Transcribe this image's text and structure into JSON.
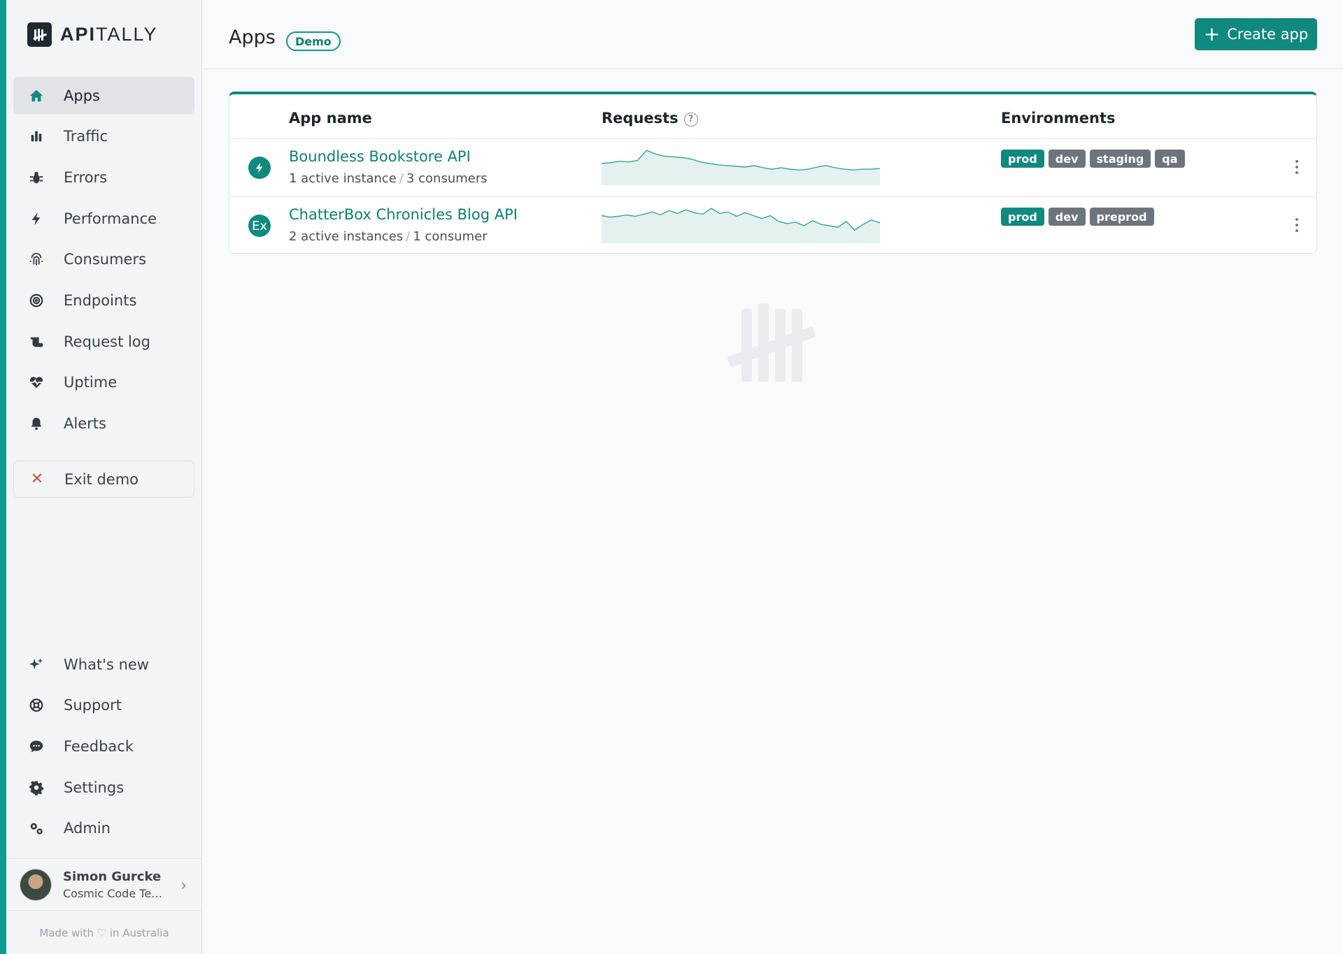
{
  "brand": {
    "name_bold": "API",
    "name_light": "TALLY"
  },
  "sidebar": {
    "items": [
      {
        "label": "Apps",
        "icon": "home-icon",
        "active": true
      },
      {
        "label": "Traffic",
        "icon": "bar-chart-icon"
      },
      {
        "label": "Errors",
        "icon": "bug-icon"
      },
      {
        "label": "Performance",
        "icon": "bolt-icon"
      },
      {
        "label": "Consumers",
        "icon": "fingerprint-icon"
      },
      {
        "label": "Endpoints",
        "icon": "target-icon"
      },
      {
        "label": "Request log",
        "icon": "scroll-icon"
      },
      {
        "label": "Uptime",
        "icon": "heartbeat-icon"
      },
      {
        "label": "Alerts",
        "icon": "bell-icon"
      }
    ],
    "exit_label": "Exit demo",
    "bottom_items": [
      {
        "label": "What's new",
        "icon": "sparkles-icon"
      },
      {
        "label": "Support",
        "icon": "lifebuoy-icon"
      },
      {
        "label": "Feedback",
        "icon": "chat-icon"
      },
      {
        "label": "Settings",
        "icon": "gear-icon"
      },
      {
        "label": "Admin",
        "icon": "gears-icon"
      }
    ]
  },
  "user": {
    "name": "Simon Gurcke",
    "org": "Cosmic Code Tea..."
  },
  "footer": {
    "prefix": "Made with",
    "suffix": "in Australia"
  },
  "header": {
    "title": "Apps",
    "badge": "Demo",
    "create_label": "Create app"
  },
  "table": {
    "columns": {
      "name": "App name",
      "requests": "Requests",
      "envs": "Environments"
    },
    "rows": [
      {
        "name": "Boundless Bookstore API",
        "instances": "1 active instance",
        "consumers": "3 consumers",
        "icon": "bolt-icon",
        "icon_text": "",
        "environments": [
          "prod",
          "dev",
          "staging",
          "qa"
        ],
        "requests_trend": [
          30,
          31,
          33,
          32,
          34,
          48,
          43,
          40,
          39,
          38,
          36,
          32,
          30,
          28,
          27,
          26,
          25,
          27,
          24,
          22,
          24,
          22,
          21,
          22,
          25,
          27,
          24,
          22,
          21,
          22,
          22,
          23
        ]
      },
      {
        "name": "ChatterBox Chronicles Blog API",
        "instances": "2 active instances",
        "consumers": "1 consumer",
        "icon": "text-badge-icon",
        "icon_text": "Ex",
        "environments": [
          "prod",
          "dev",
          "preprod"
        ],
        "requests_trend": [
          38,
          36,
          37,
          39,
          37,
          40,
          43,
          39,
          45,
          41,
          46,
          42,
          40,
          48,
          41,
          43,
          37,
          42,
          38,
          34,
          38,
          30,
          27,
          29,
          24,
          31,
          26,
          24,
          22,
          30,
          18,
          26,
          32,
          28
        ]
      }
    ]
  },
  "colors": {
    "accent": "#10897f",
    "env_other": "#6c757d"
  }
}
